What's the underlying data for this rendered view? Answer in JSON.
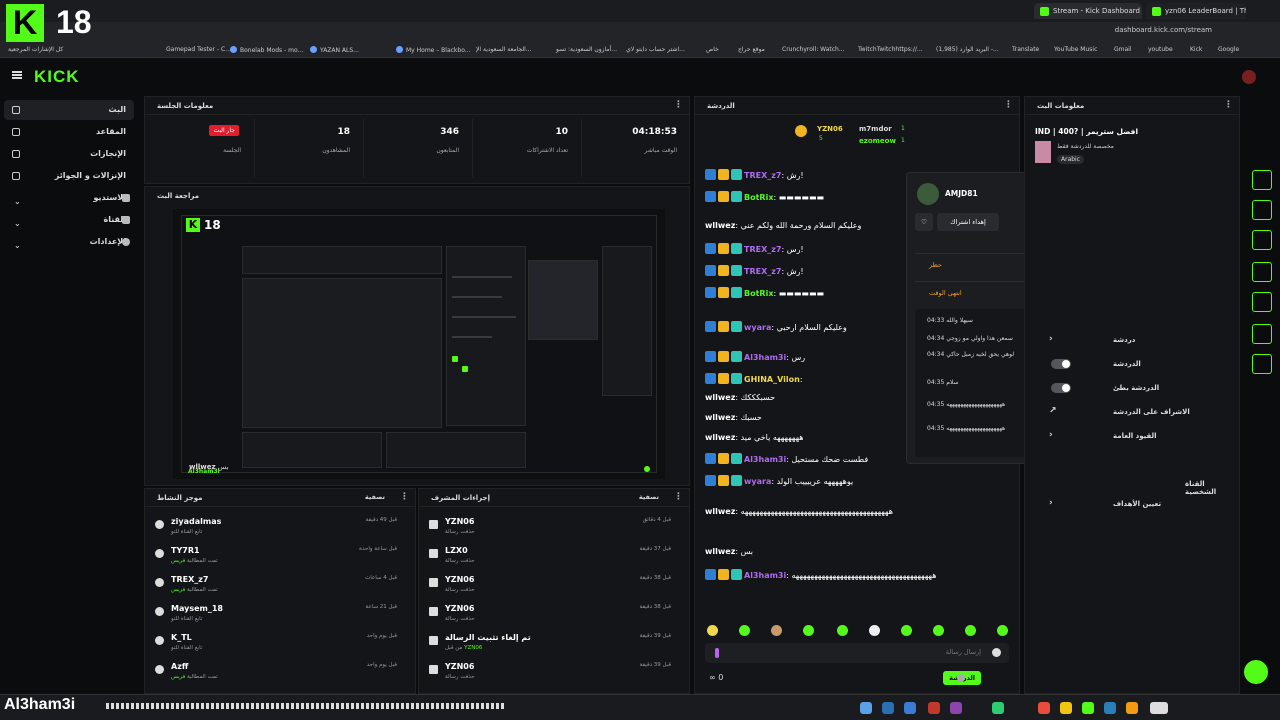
{
  "browser": {
    "tabs": [
      "Stream - Kick Dashboard",
      "yzn06 LeaderBoard | The best"
    ],
    "url": "dashboard.kick.com/stream",
    "bookmarks": [
      "Gamepad Tester - C...",
      "Bonelab Mods - mo...",
      "YAZAN ALS...",
      "البريد",
      "My Home – Blackbo...",
      "الجامعة السعودية الإ...",
      "أمازون السعودية: تسو...",
      "اشتر حساب دايتو لاي...",
      "خاص",
      "موقع حراج",
      "Crunchyroll: Watch...",
      "TwitchTwitchhttps://...",
      "(1,985) البريد الوارد -...",
      "Translate",
      "YouTube Music",
      "Gmail",
      "youtube",
      "Kick",
      "Google"
    ],
    "left_bm": "كل الإشارات المرجعية"
  },
  "overlay": {
    "logo": "K",
    "number": "18"
  },
  "app": {
    "logo": "KICK"
  },
  "nav": {
    "items": [
      {
        "label": "البث"
      },
      {
        "label": "المقاعد"
      },
      {
        "label": "الإنجازات"
      },
      {
        "label": "الإنزالات و الجوائز"
      },
      {
        "label": "الاستديو"
      },
      {
        "label": "القناة"
      },
      {
        "label": "الإعدادات"
      }
    ]
  },
  "session": {
    "title": "معلومات الجلسة",
    "live_badge": "جار البث",
    "live_label": "الجلسة",
    "stats": [
      {
        "value": "04:18:53",
        "label": "الوقت مباشر"
      },
      {
        "value": "10",
        "label": "تعداد الاشتراكات"
      },
      {
        "value": "346",
        "label": "المتابعون"
      },
      {
        "value": "18",
        "label": "المشاهدون"
      }
    ]
  },
  "preview": {
    "title": "مراجعة البث",
    "chat_user": "wllwez",
    "chat_text": "بس",
    "chat_user2": "Al3ham3i"
  },
  "activity": {
    "title": "موجز النشاط",
    "filter": "تصفية",
    "rows": [
      {
        "name": "ziyadalmas",
        "sub": "تابع القناة للتو",
        "time": "قبل 49 دقيقة"
      },
      {
        "name": "TY7R1",
        "sub": "تمت المطالبة",
        "sub_hl": "فريس",
        "time": "قبل ساعة واحدة"
      },
      {
        "name": "TREX_z7",
        "sub": "تمت المطالبة",
        "sub_hl": "فريس",
        "time": "قبل 4 ساعات"
      },
      {
        "name": "Maysem_18",
        "sub": "تابع القناة للتو",
        "time": "قبل 21 ساعة"
      },
      {
        "name": "K_TL",
        "sub": "تابع القناة للتو",
        "time": "قبل يوم واحد"
      },
      {
        "name": "Azff",
        "sub": "تمت المطالبة",
        "sub_hl": "فريس",
        "time": "قبل يوم واحد"
      }
    ]
  },
  "modactions": {
    "title": "إجراءات المشرف",
    "filter": "تصفية",
    "rows": [
      {
        "name": "YZN06",
        "sub": "حذفت رسالة",
        "time": "قبل 4 دقائق"
      },
      {
        "name": "LZX0",
        "sub": "حذفت رسالة",
        "time": "قبل 37 دقيقة"
      },
      {
        "name": "YZN06",
        "sub": "حذفت رسالة",
        "time": "قبل 38 دقيقة"
      },
      {
        "name": "YZN06",
        "sub": "حذفت رسالة",
        "time": "قبل 38 دقيقة"
      },
      {
        "name": "تم إلغاء تثبيت الرسالة",
        "sub": "من قبل",
        "sub_hl": "YZN06",
        "time": "قبل 39 دقيقة"
      },
      {
        "name": "YZN06",
        "sub": "حذفت رسالة",
        "time": "قبل 39 دقيقة"
      }
    ]
  },
  "chat": {
    "title": "الدردشة",
    "pinned": [
      {
        "name": "YZN06",
        "count": "5"
      },
      {
        "name": "m7mdor",
        "count": "1"
      },
      {
        "name": "ezomeow",
        "count": "1"
      }
    ],
    "messages": [
      {
        "user": "TREX_z7",
        "color": "#b06cf0",
        "text": "رش!"
      },
      {
        "user": "BotRix",
        "color": "#53fc18",
        "text": "▬▬▬▬▬▬"
      },
      {
        "user": "wllwez",
        "color": "#ffffff",
        "text": "وعليكم السلام ورحمة الله ولكم عني"
      },
      {
        "user": "TREX_z7",
        "color": "#b06cf0",
        "text": "رس!"
      },
      {
        "user": "TREX_z7",
        "color": "#b06cf0",
        "text": "رش!"
      },
      {
        "user": "BotRix",
        "color": "#53fc18",
        "text": "▬▬▬▬▬▬"
      },
      {
        "user": "wyara",
        "color": "#b06cf0",
        "text": "وعليكم السلام ارحبي"
      },
      {
        "user": "Al3ham3i",
        "color": "#b06cf0",
        "text": "رس"
      },
      {
        "user": "GHINA_Vilon",
        "color": "#f0d84a",
        "text": ""
      },
      {
        "user": "wllwez",
        "color": "#ffffff",
        "text": "حسبكككك"
      },
      {
        "user": "wllwez",
        "color": "#ffffff",
        "text": "حسبك"
      },
      {
        "user": "wllwez",
        "color": "#ffffff",
        "text": "هههههههه ياخي ميد"
      },
      {
        "user": "Al3ham3i",
        "color": "#b06cf0",
        "text": "فطست ضحك مستحيل"
      },
      {
        "user": "wyara",
        "color": "#b06cf0",
        "text": "يوهههههه عرييييب الولد"
      },
      {
        "user": "wllwez",
        "color": "#ffffff",
        "text": "ههههههههههههههههههههههههههههههههههههههههه"
      },
      {
        "user": "wllwez",
        "color": "#ffffff",
        "text": "بس"
      },
      {
        "user": "Al3ham3i",
        "color": "#b06cf0",
        "text": "ههههههههههههههههههههههههههههههههههههههه"
      }
    ],
    "input_placeholder": "إرسال رسالة",
    "send": "الدردشة",
    "footer_count": "0"
  },
  "popup": {
    "name": "AMJD81",
    "sub_button": "إهداء اشتراك",
    "ban": "حظر",
    "timeout": "انتهى الوقت",
    "log": [
      "سيهلا والله 04:33",
      "سمعن هذا واولي مو زوجي 04:34",
      "لوهي يحق لخيه زمبل حاكي 04:34",
      "سلام 04:35",
      "ههههههههههههههههههههه 04:35",
      "ههههههههههههههههههههه 04:35"
    ]
  },
  "streaminfo": {
    "title": "معلومات البث",
    "stream_title": "IND | 400? | افضل ستريمر",
    "category": "مخصصة للدردشة فقط",
    "tag": "Arabic",
    "items": [
      "دردشة",
      "الدردشة",
      "الدردشة بطئ",
      "الاشراف على الدردشة",
      "القيود العامة",
      "القناة الشخصية",
      "تعيين الأهداف"
    ]
  },
  "bottom": {
    "name": "Al3ham3i"
  }
}
